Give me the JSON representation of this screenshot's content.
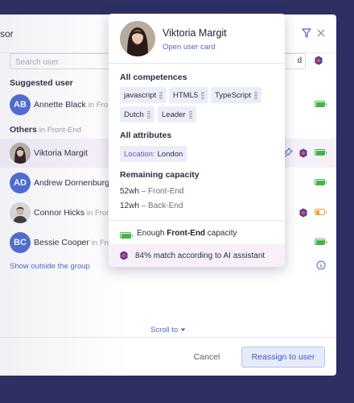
{
  "modal": {
    "title_fragment": "sor",
    "search_placeholder": "Search user",
    "search_tail": "d",
    "suggested_label": "Suggested user",
    "others_label": "Others",
    "others_sub": "in Front-End",
    "show_outside": "Show outside the group",
    "scroll_to": "Scroll to",
    "cancel": "Cancel",
    "reassign": "Reassign to user"
  },
  "users": [
    {
      "initials": "AB",
      "name": "Annette Black",
      "sub": "in Fro",
      "avatar_color": "#4b6ad3"
    },
    {
      "name": "Viktoria Margit",
      "avatar": "photo"
    },
    {
      "initials": "AD",
      "name": "Andrew Dornenburg",
      "avatar_color": "#4b6ad3"
    },
    {
      "name": "Connor Hicks",
      "sub": "in Fron",
      "avatar": "photo"
    },
    {
      "initials": "BC",
      "name": "Bessie Cooper",
      "sub": "in Fro",
      "avatar_color": "#4b6ad3"
    }
  ],
  "popover": {
    "name": "Viktoria Margit",
    "link": "Open user card",
    "competences_label": "All competences",
    "competences": [
      "javascript",
      "HTML5",
      "TypeScript",
      "Dutch",
      "Leader"
    ],
    "attributes_label": "All attributes",
    "attribute_key": "Location:",
    "attribute_value": "London",
    "capacity_label": "Remaining capacity",
    "capacity": [
      {
        "amount": "52wh",
        "sep": " – ",
        "group": "Front-End"
      },
      {
        "amount": "12wh",
        "sep": " – ",
        "group": "Back-End"
      }
    ],
    "enough_pre": "Enough ",
    "enough_bold": "Front-End",
    "enough_post": " capacity",
    "ai_text": "84% match according to AI assistant"
  },
  "colors": {
    "background": "#2e2f63",
    "accent": "#4c67c7",
    "avatar_blue": "#4b6ad3",
    "capacity_ok": "#47b347",
    "capacity_low": "#f0a030"
  },
  "icons": [
    "filter-icon",
    "close-icon",
    "ai-assistant-icon",
    "battery-icon",
    "pin-icon",
    "info-icon",
    "caret-down-icon"
  ]
}
